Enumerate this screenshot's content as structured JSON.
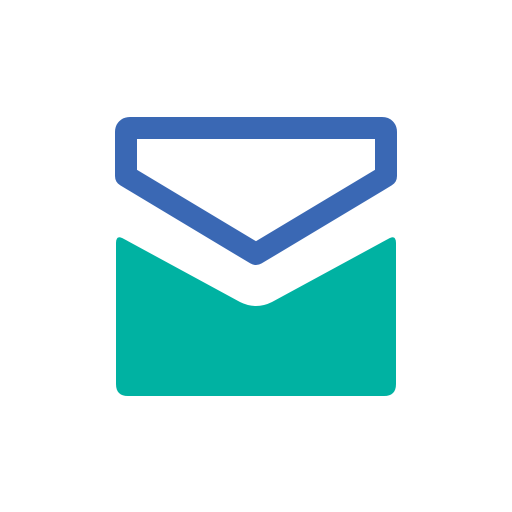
{
  "icon": {
    "name": "mail-envelope-icon",
    "colors": {
      "background": "#ffffff",
      "flap_stroke": "#3a68b4",
      "body_fill": "#00b2a2"
    }
  }
}
